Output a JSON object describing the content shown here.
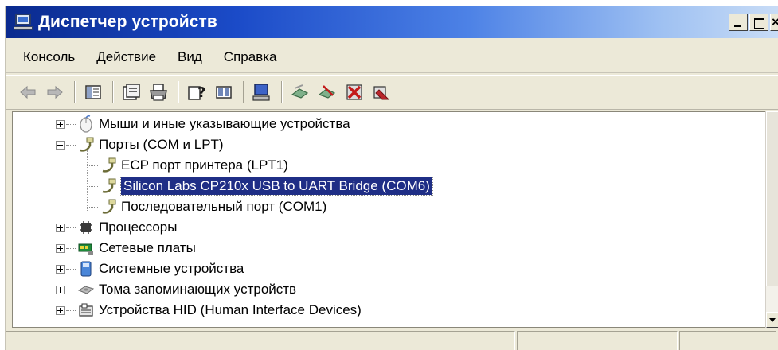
{
  "window": {
    "title": "Диспетчер устройств"
  },
  "menu": [
    {
      "label": "Консоль"
    },
    {
      "label": "Действие"
    },
    {
      "label": "Вид"
    },
    {
      "label": "Справка"
    }
  ],
  "toolbar": {
    "buttons": [
      "back-icon",
      "forward-icon",
      "show-hide-tree-icon",
      "properties-icon",
      "print-icon",
      "help-icon",
      "view-icon",
      "computer-icon",
      "scan-hardware-icon",
      "disable-device-icon",
      "uninstall-device-icon"
    ]
  },
  "tree": {
    "items": [
      {
        "label": "Мыши и иные указывающие устройства",
        "icon": "mouse-icon",
        "expander": "plus"
      },
      {
        "label": "Порты (COM и LPT)",
        "icon": "port-icon",
        "expander": "minus"
      },
      {
        "label": "ECP порт принтера (LPT1)",
        "icon": "port-icon"
      },
      {
        "label": "Silicon Labs CP210x USB to UART Bridge (COM6)",
        "icon": "port-icon",
        "selected": true
      },
      {
        "label": "Последовательный порт (COM1)",
        "icon": "port-icon"
      },
      {
        "label": "Процессоры",
        "icon": "processor-icon",
        "expander": "plus"
      },
      {
        "label": "Сетевые платы",
        "icon": "network-card-icon",
        "expander": "plus"
      },
      {
        "label": "Системные устройства",
        "icon": "system-device-icon",
        "expander": "plus"
      },
      {
        "label": "Тома запоминающих устройств",
        "icon": "storage-volume-icon",
        "expander": "plus"
      },
      {
        "label": "Устройства HID (Human Interface Devices)",
        "icon": "hid-icon",
        "expander": "plus"
      }
    ]
  },
  "colors": {
    "selection": "#1f2e86",
    "title_start": "#0a2a8e",
    "title_end": "#c8dcf6",
    "chrome": "#ece9d8"
  }
}
